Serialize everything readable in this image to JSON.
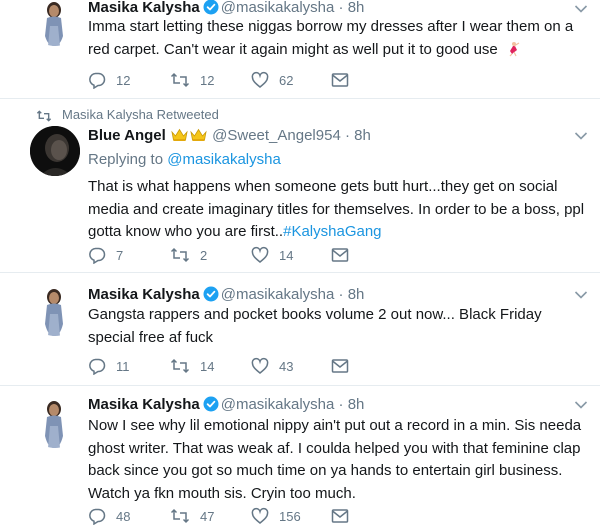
{
  "colors": {
    "link": "#1b95e0",
    "secondary": "#657786",
    "divider": "#e6ecf0",
    "verified": "#1da1f2"
  },
  "tweets": [
    {
      "name": "Masika Kalysha",
      "handle": "@masikakalysha",
      "time": "8h",
      "text": "Imma start letting these niggas borrow my dresses after I wear them on a red carpet. Can't wear it again might as well put it to good use",
      "emoji": "dancer-emoji",
      "replies": "12",
      "retweets": "12",
      "likes": "62"
    },
    {
      "retweet_context": "Masika Kalysha Retweeted",
      "name": "Blue Angel",
      "badges": "crown-emoji crown-emoji",
      "handle": "@Sweet_Angel954",
      "time": "8h",
      "replying_prefix": "Replying to",
      "replying_handle": "@masikakalysha",
      "text": "That is what happens when someone gets butt hurt...they get on social media and create imaginary titles for themselves. In order to be a boss, ppl gotta know who you are first..",
      "hashtag": "#KalyshaGang",
      "replies": "7",
      "retweets": "2",
      "likes": "14"
    },
    {
      "name": "Masika Kalysha",
      "handle": "@masikakalysha",
      "time": "8h",
      "text": "Gangsta rappers and pocket books volume 2 out now... Black Friday special free af fuck",
      "replies": "11",
      "retweets": "14",
      "likes": "43"
    },
    {
      "name": "Masika Kalysha",
      "handle": "@masikakalysha",
      "time": "8h",
      "text": "Now I see why lil emotional nippy ain't put out a record in a min. Sis needa ghost writer. That was weak af. I coulda helped you with that feminine clap back since you got so much time on ya hands to entertain girl business. Watch ya fkn mouth sis. Cryin too much.",
      "replies": "48",
      "retweets": "47",
      "likes": "156"
    }
  ]
}
